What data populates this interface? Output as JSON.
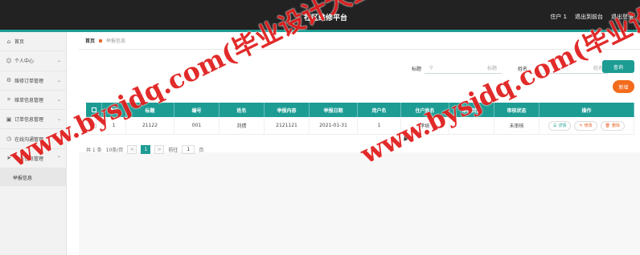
{
  "header": {
    "title": "社区维修平台",
    "user": "住户 1",
    "to_front": "退出到前台",
    "logout": "退出登录"
  },
  "sidebar": {
    "items": [
      {
        "label": "首页",
        "icon": "home-icon"
      },
      {
        "label": "个人中心",
        "icon": "user-icon"
      },
      {
        "label": "维修订单管理",
        "icon": "settings-icon"
      },
      {
        "label": "维单信息管理",
        "icon": "crop-icon"
      },
      {
        "label": "订单信息管理",
        "icon": "calendar-icon"
      },
      {
        "label": "在线沟通管理",
        "icon": "clock-icon"
      },
      {
        "label": "举报信息管理",
        "icon": "send-icon"
      }
    ],
    "sub_item": "举报信息"
  },
  "breadcrumb": {
    "home": "首页",
    "current": "举报信息"
  },
  "search": {
    "label1": "标题",
    "placeholder1": "标题",
    "label2": "姓名",
    "placeholder2": "姓名",
    "button": "查询",
    "add": "新增"
  },
  "table": {
    "headers": [
      "索引",
      "标题",
      "编号",
      "姓名",
      "举报内容",
      "举报日期",
      "用户名",
      "住户姓名",
      "审核回复",
      "审核状态",
      "操作"
    ],
    "rows": [
      [
        "1",
        "21122",
        "001",
        "刘倩",
        "2121121",
        "2021-01-31",
        "1",
        "李统",
        "",
        "未审核",
        ""
      ]
    ],
    "actions": [
      "详情",
      "修改",
      "删除"
    ]
  },
  "pager": {
    "total": "共 1 条",
    "page_size": "10条/页",
    "prev": "<",
    "current": "1",
    "next": ">",
    "goto_prefix": "前往",
    "goto_value": "1",
    "goto_suffix": "页"
  },
  "watermark": {
    "text": "www.bysjdq.com(毕业设计大全)",
    "text2": "www.bysjdq.com(毕业设计"
  },
  "colors": {
    "accent": "#1d9c94",
    "add_button": "#f36b1c",
    "watermark": "#e0201f",
    "topbar": "#222222"
  }
}
